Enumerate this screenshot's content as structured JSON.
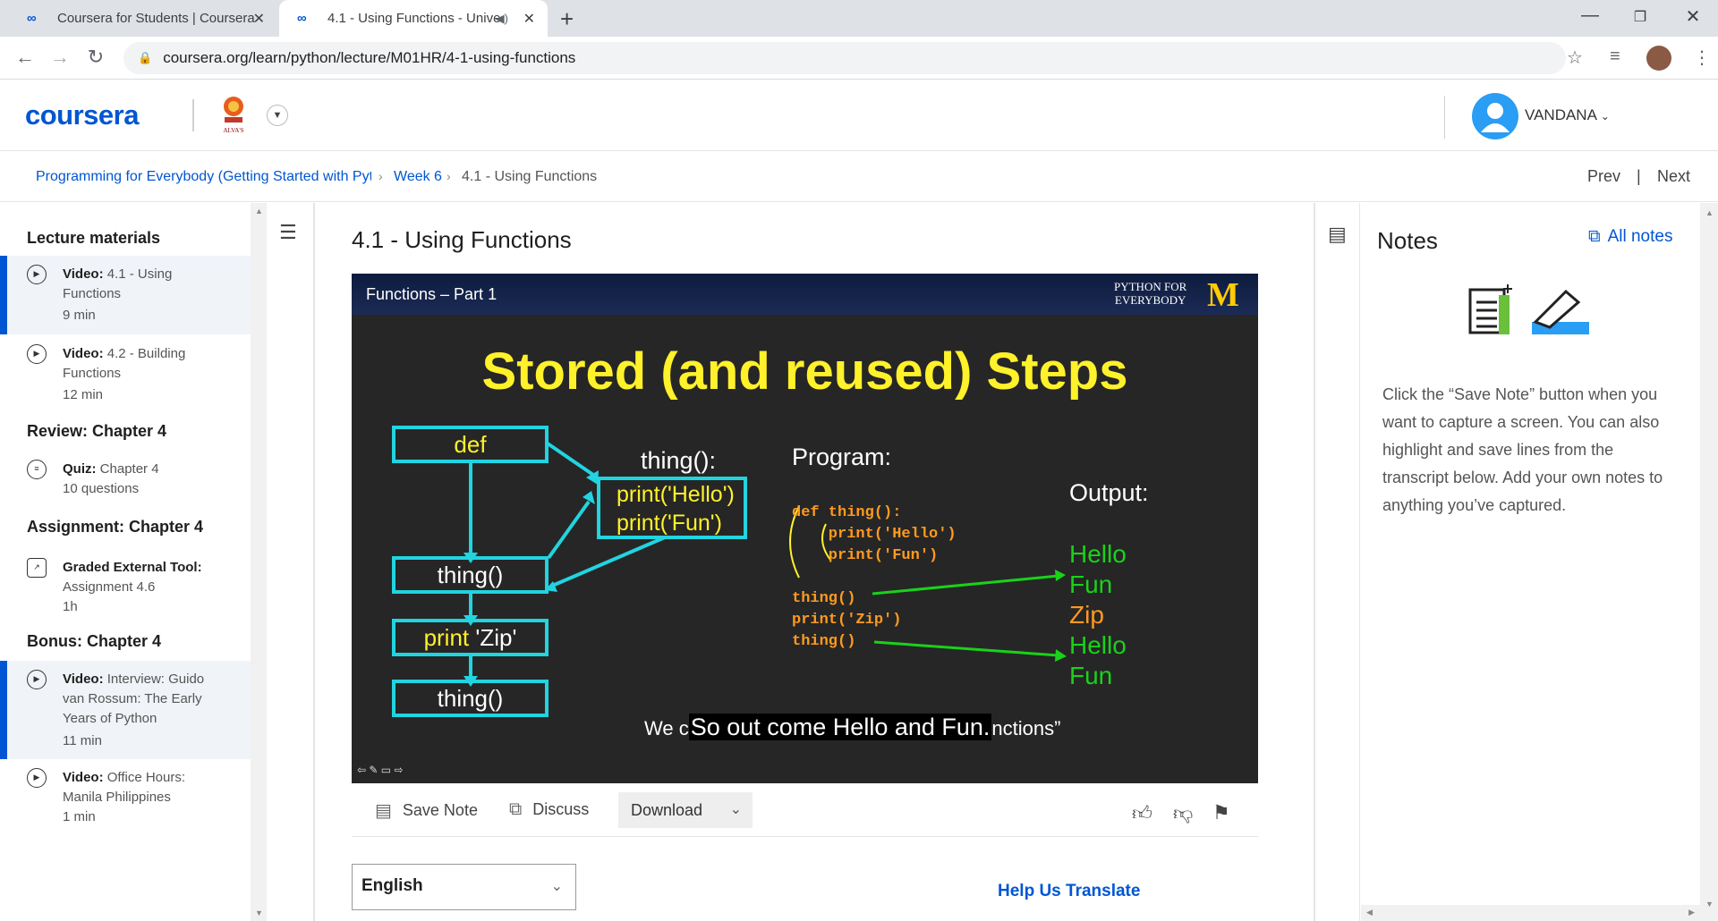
{
  "browser": {
    "tabs": [
      {
        "title": "Coursera for Students | Coursera"
      },
      {
        "title": "4.1 - Using Functions - Unive"
      }
    ],
    "new_tab": "+",
    "url": "coursera.org/learn/python/lecture/M01HR/4-1-using-functions"
  },
  "header": {
    "logo": "coursera",
    "institution": "ALVA'S",
    "username": "VANDANA"
  },
  "breadcrumb": {
    "course": "Programming for Everybody (Getting Started with Pytl",
    "week": "Week 6",
    "current": "4.1 - Using Functions",
    "prev": "Prev",
    "separator": "|",
    "next": "Next"
  },
  "sidebar": {
    "sections": [
      {
        "title": "Lecture materials"
      },
      {
        "title": "Review: Chapter 4"
      },
      {
        "title": "Assignment: Chapter 4"
      },
      {
        "title": "Bonus: Chapter 4"
      }
    ],
    "items": [
      {
        "type": "Video:",
        "name": "4.1 - Using Functions",
        "duration": "9 min",
        "active": true
      },
      {
        "type": "Video:",
        "name": "4.2 - Building Functions",
        "duration": "12 min",
        "active": false
      },
      {
        "type": "Quiz:",
        "name": "Chapter 4",
        "duration": "10 questions",
        "active": false
      },
      {
        "type": "Graded External Tool:",
        "name": "Assignment 4.6",
        "duration": "1h",
        "active": false
      },
      {
        "type": "Video:",
        "name": "Interview: Guido van Rossum: The Early Years of Python",
        "duration": "11 min",
        "active": true
      },
      {
        "type": "Video:",
        "name": "Office Hours: Manila Philippines",
        "duration": "1 min",
        "active": false
      }
    ]
  },
  "lecture": {
    "title": "4.1 - Using Functions"
  },
  "video": {
    "header_title": "Functions – Part 1",
    "brand_line1": "PYTHON FOR",
    "brand_line2": "EVERYBODY",
    "brand_mark": "M",
    "slide_title": "Stored (and reused) Steps",
    "flow_def": "def",
    "flow_thing1": "thing()",
    "flow_print_kw": "print",
    "flow_print_arg": " 'Zip'",
    "flow_thing2": "thing()",
    "fn_header": "thing():",
    "fn_line1": "print('Hello')",
    "fn_line2": "print('Fun')",
    "program_label": "Program:",
    "output_label": "Output:",
    "code_lines": [
      "def thing():",
      "    print('Hello')",
      "    print('Fun')",
      "thing()",
      "print('Zip')",
      "thing()"
    ],
    "outputs": [
      "Hello",
      "Fun",
      "Zip",
      "Hello",
      "Fun"
    ],
    "caption_left": "We c",
    "caption_cc": "So out come Hello and Fun.",
    "caption_right": "nctions”"
  },
  "actions": {
    "save_note": "Save Note",
    "discuss": "Discuss",
    "download": "Download"
  },
  "language": {
    "selected": "English",
    "help": "Help Us Translate"
  },
  "notes": {
    "title": "Notes",
    "all_notes": "All notes",
    "description": "Click the “Save Note” button when you want to capture a screen. You can also highlight and save lines from the transcript below. Add your own notes to anything you’ve captured."
  }
}
